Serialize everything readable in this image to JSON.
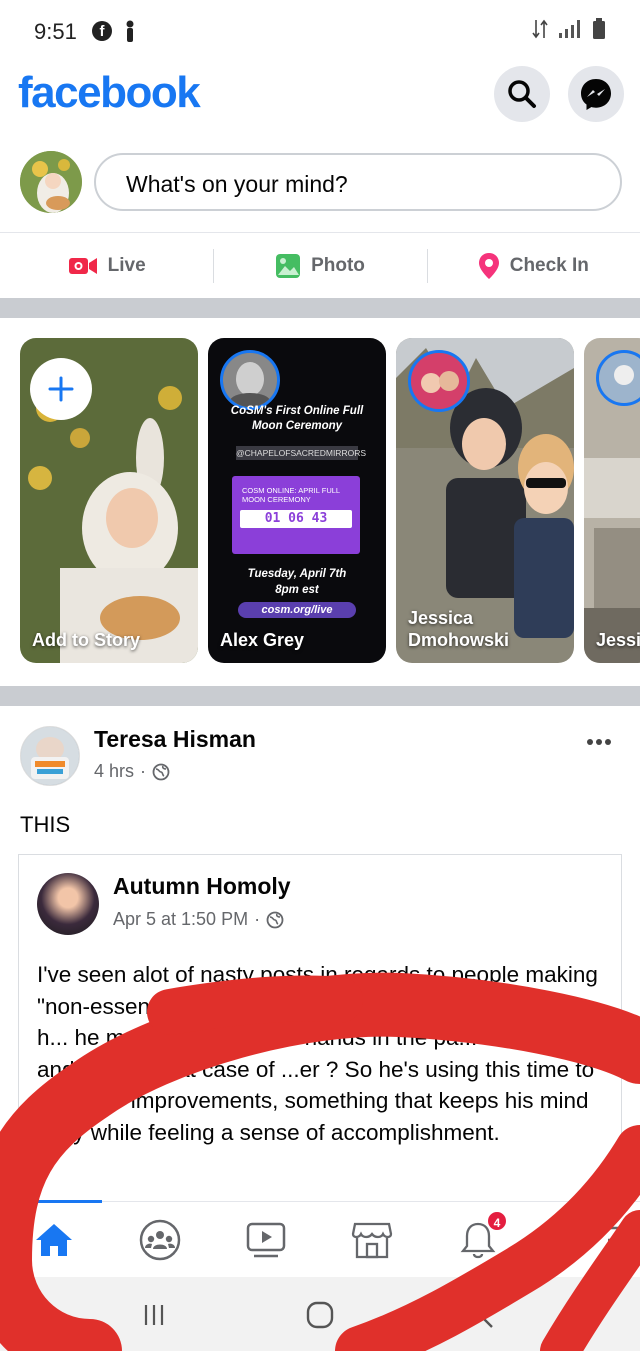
{
  "status": {
    "time": "9:51",
    "fb_glyph": "f"
  },
  "header": {
    "logo": "facebook"
  },
  "composer": {
    "placeholder": "What's on your mind?"
  },
  "actions": [
    {
      "label": "Live"
    },
    {
      "label": "Photo"
    },
    {
      "label": "Check In"
    }
  ],
  "stories": {
    "add_label": "Add to Story",
    "items": [
      {
        "name": "Alex Grey",
        "card": {
          "title": "CoSM's First Online Full Moon Ceremony",
          "handle": "@CHAPELOFSACREDMIRRORS",
          "box_title": "COSM ONLINE: APRIL FULL MOON CEREMONY",
          "countdown": "01 06 43",
          "date": "Tuesday, April 7th",
          "time": "8pm est",
          "link": "cosm.org/live"
        }
      },
      {
        "name": "Jessica Dmohowski"
      },
      {
        "name": "Jessi"
      }
    ]
  },
  "post": {
    "author": "Teresa Hisman",
    "time": "4 hrs",
    "text": "THIS",
    "shared": {
      "author": "Autumn Homoly",
      "time": "Apr 5 at 1:50 PM",
      "body": "I've seen alot of nasty posts in regards to people making \"non-essential\" trips .. Do you ever think maybe that guy h... he must k... cause idle hands in the pa... to relapse and pick up that case of ...er ? So he's using this time to do home improvements, something that keeps his mind busy while feeling a sense of accomplishment."
    }
  },
  "tabbar": {
    "notifications_badge": "4"
  },
  "colors": {
    "brand": "#1877f2",
    "live": "#f02849",
    "photo": "#45bd62",
    "checkin": "#f5337b",
    "scribble": "#e0302b"
  }
}
